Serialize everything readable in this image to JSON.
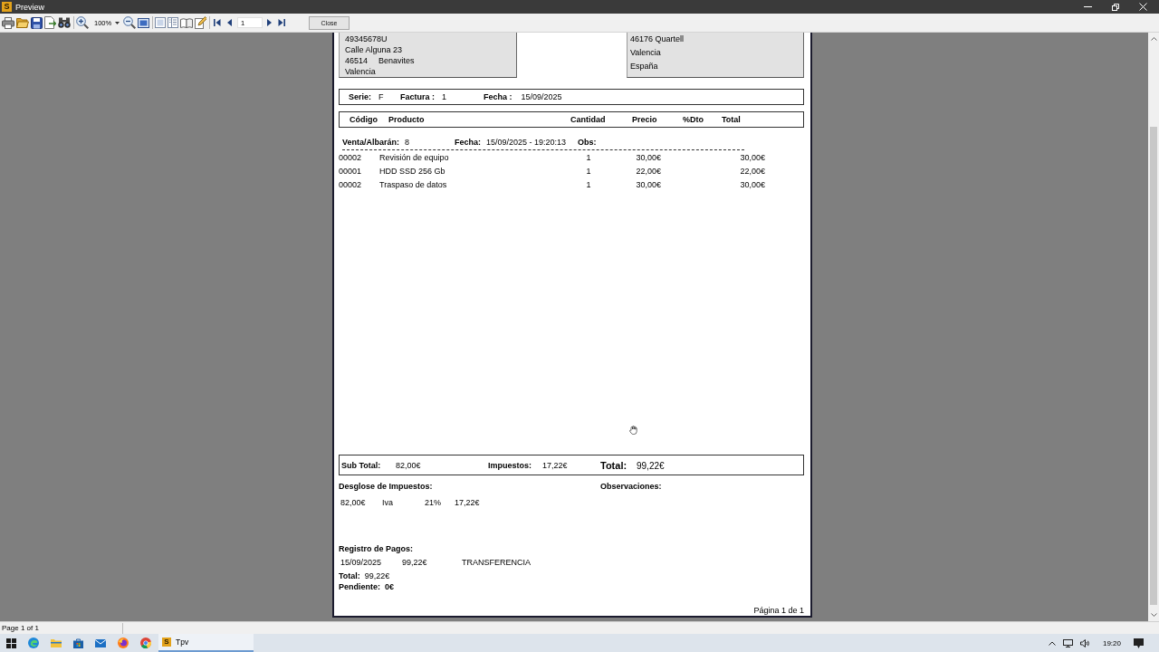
{
  "window": {
    "icon_letter": "S",
    "title": "Preview"
  },
  "toolbar": {
    "zoom": "100%",
    "page": "1",
    "close_button": "Close"
  },
  "document": {
    "issuer": {
      "tax_id": "49345678U",
      "street": "Calle Alguna 23",
      "postal_code": "46514",
      "city": "Benavites",
      "province": "Valencia"
    },
    "client": {
      "postal_line": "46176 Quartell",
      "province": "Valencia",
      "country": "España"
    },
    "header": [
      {
        "label": "Serie:",
        "value": "F"
      },
      {
        "label": "Factura :",
        "value": "1"
      },
      {
        "label": "Fecha :",
        "value": "15/09/2025"
      }
    ],
    "columns": [
      "Código",
      "Producto",
      "Cantidad",
      "Precio",
      "%Dto",
      "Total"
    ],
    "sale": [
      {
        "label": "Venta/Albarán:",
        "value": "8"
      },
      {
        "label": "Fecha:",
        "value": "15/09/2025 - 19:20:13"
      },
      {
        "label": "Obs:"
      }
    ],
    "rows": [
      {
        "code": "00002",
        "product": "Revisión de equipo",
        "quantity": "1",
        "price": "30,00€",
        "total": "30,00€"
      },
      {
        "code": "00001",
        "product": "HDD SSD 256 Gb",
        "quantity": "1",
        "price": "22,00€",
        "total": "22,00€"
      },
      {
        "code": "00002",
        "product": "Traspaso de datos",
        "quantity": "1",
        "price": "30,00€",
        "total": "30,00€"
      }
    ],
    "totals": [
      {
        "kind": "sum",
        "label": "Sub Total:",
        "value": "82,00€"
      },
      {
        "kind": "sum",
        "label": "Impuestos:",
        "value": "17,22€"
      },
      {
        "kind": "grand",
        "label": "Total:",
        "value": "99,22€"
      }
    ],
    "tax_breakdown": {
      "title": "Desglose de Impuestos:",
      "rows": [
        {
          "base": "82,00€",
          "tax": "Iva",
          "rate": "21%",
          "amount": "17,22€"
        }
      ]
    },
    "observations": {
      "title": "Observaciones:"
    },
    "payments": {
      "title": "Registro de Pagos:",
      "rows": [
        {
          "date": "15/09/2025",
          "amount": "99,22€",
          "method": "TRANSFERENCIA"
        }
      ],
      "total_label": "Total:",
      "total": "99,22€",
      "pending_label": "Pendiente:",
      "pending": "0€"
    },
    "page_footer": "Página 1 de 1"
  },
  "status_bar": {
    "text": "Page 1 of 1"
  },
  "taskbar": {
    "apps": [
      {
        "icon_letter": "S",
        "label": "Tpv",
        "selected": true
      }
    ],
    "clock": "19:20"
  }
}
